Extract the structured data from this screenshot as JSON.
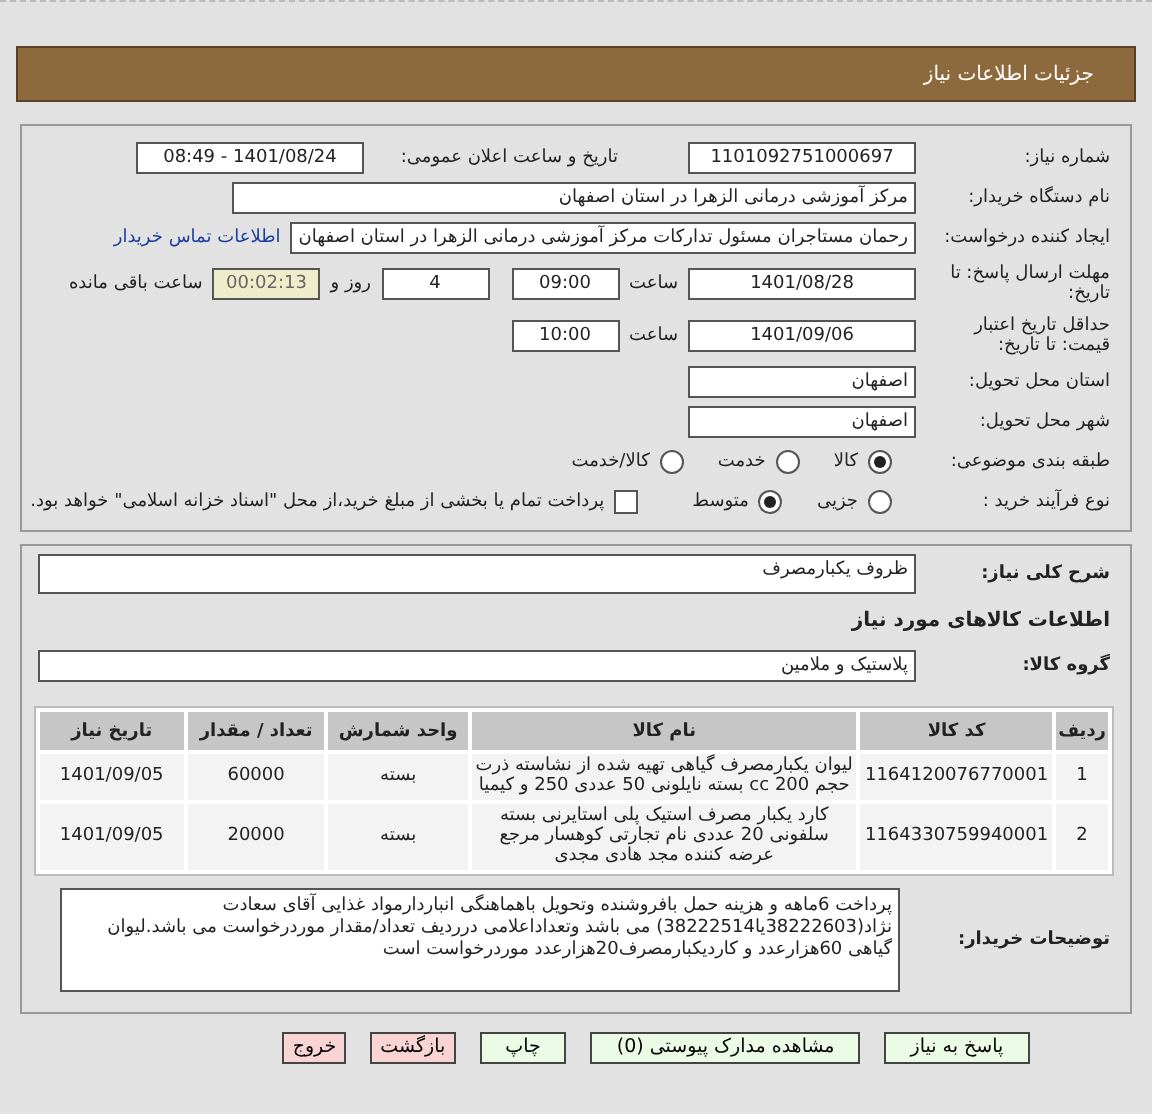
{
  "header": {
    "title": "جزئیات اطلاعات نیاز"
  },
  "need_number": {
    "label": "شماره نیاز:",
    "value": "1101092751000697"
  },
  "announce": {
    "label": "تاریخ و ساعت اعلان عمومی:",
    "value": "1401/08/24 - 08:49"
  },
  "buyer": {
    "label": "نام دستگاه خریدار:",
    "value": "مرکز آموزشی درمانی الزهرا در استان اصفهان"
  },
  "creator": {
    "label": "ایجاد کننده درخواست:",
    "value": "رحمان مستاجران مسئول تدارکات مرکز آموزشی درمانی الزهرا در استان اصفهان",
    "link": "اطلاعات تماس خریدار"
  },
  "deadline": {
    "label": "مهلت ارسال پاسخ: تا تاریخ:",
    "date": "1401/08/28",
    "time_label": "ساعت",
    "time": "09:00",
    "days": "4",
    "days_label": "روز و",
    "remaining": "00:02:13",
    "remaining_label": "ساعت باقی مانده"
  },
  "validity": {
    "label": "حداقل تاریخ اعتبار قیمت: تا تاریخ:",
    "date": "1401/09/06",
    "time_label": "ساعت",
    "time": "10:00"
  },
  "province": {
    "label": "استان محل تحویل:",
    "value": "اصفهان"
  },
  "city": {
    "label": "شهر محل تحویل:",
    "value": "اصفهان"
  },
  "category": {
    "label": "طبقه بندی موضوعی:",
    "options": [
      {
        "label": "کالا",
        "selected": true
      },
      {
        "label": "خدمت",
        "selected": false
      },
      {
        "label": "کالا/خدمت",
        "selected": false
      }
    ]
  },
  "process": {
    "label": "نوع فرآیند خرید :",
    "options": [
      {
        "label": "جزیی",
        "selected": false
      },
      {
        "label": "متوسط",
        "selected": true
      }
    ],
    "treasury": {
      "label": "پرداخت تمام یا بخشی از مبلغ خرید،از محل \"اسناد خزانه اسلامی\" خواهد بود.",
      "checked": false
    }
  },
  "description": {
    "label": "شرح کلی نیاز:",
    "value": "ظروف یکبارمصرف"
  },
  "goods_title": "اطلاعات کالاهای مورد نیاز",
  "goods_group": {
    "label": "گروه کالا:",
    "value": "پلاستیک و ملامین"
  },
  "table": {
    "columns": [
      "ردیف",
      "کد کالا",
      "نام کالا",
      "واحد شمارش",
      "تعداد / مقدار",
      "تاریخ نیاز"
    ],
    "rows": [
      [
        "1",
        "1164120076770001",
        "لیوان یکبارمصرف گیاهی تهیه شده از نشاسته ذرت حجم 200 cc بسته نایلونی 50 عددی 250 و کیمیا",
        "بسته",
        "60000",
        "1401/09/05"
      ],
      [
        "2",
        "1164330759940001",
        "کارد یکبار مصرف استیک پلی استایرنی بسته سلفونی 20 عددی نام تجارتی کوهسار مرجع عرضه کننده مجد هادی مجدی",
        "بسته",
        "20000",
        "1401/09/05"
      ]
    ]
  },
  "buyer_notes": {
    "label": "توضیحات خریدار:",
    "value": "پرداخت 6ماهه و هزینه حمل بافروشنده وتحویل باهماهنگی انباردارمواد غذایی   آقای سعادت نژاد(38222603یا38222514) می باشد وتعداداعلامی درردیف تعداد/مقدار موردرخواست می باشد.لیوان گیاهی 60هزارعدد و کاردیکبارمصرف20هزارعدد موردرخواست است"
  },
  "buttons": [
    {
      "label": "پاسخ به نیاز",
      "kind": "primary"
    },
    {
      "label": "مشاهده مدارک پیوستی (0)",
      "kind": "primary"
    },
    {
      "label": "چاپ",
      "kind": "primary"
    },
    {
      "label": "بازگشت",
      "kind": "danger"
    },
    {
      "label": "خروج",
      "kind": "danger"
    }
  ]
}
